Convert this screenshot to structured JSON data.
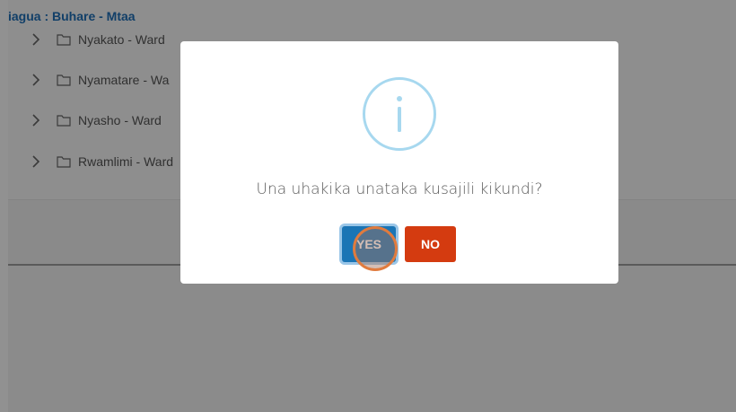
{
  "header": {
    "title": "iagua : Buhare - Mtaa"
  },
  "tree": {
    "items": [
      {
        "label": "Nyakato - Ward",
        "icon": "chevron-right-icon",
        "folder_icon": "folder-icon"
      },
      {
        "label": "Nyamatare - Wa",
        "icon": "chevron-right-icon",
        "folder_icon": "folder-icon"
      },
      {
        "label": "Nyasho - Ward",
        "icon": "chevron-right-icon",
        "folder_icon": "folder-icon"
      },
      {
        "label": "Rwamlimi - Ward",
        "icon": "chevron-right-icon",
        "folder_icon": "folder-icon"
      }
    ]
  },
  "modal": {
    "icon": "info-icon",
    "message": "Una uhakika unataka kusajili kikundi?",
    "yes_label": "YES",
    "no_label": "NO",
    "colors": {
      "yes": "#1b75b5",
      "no": "#d43b10",
      "icon_ring": "#a7d8ef",
      "header_link": "#1f6fb8"
    }
  }
}
